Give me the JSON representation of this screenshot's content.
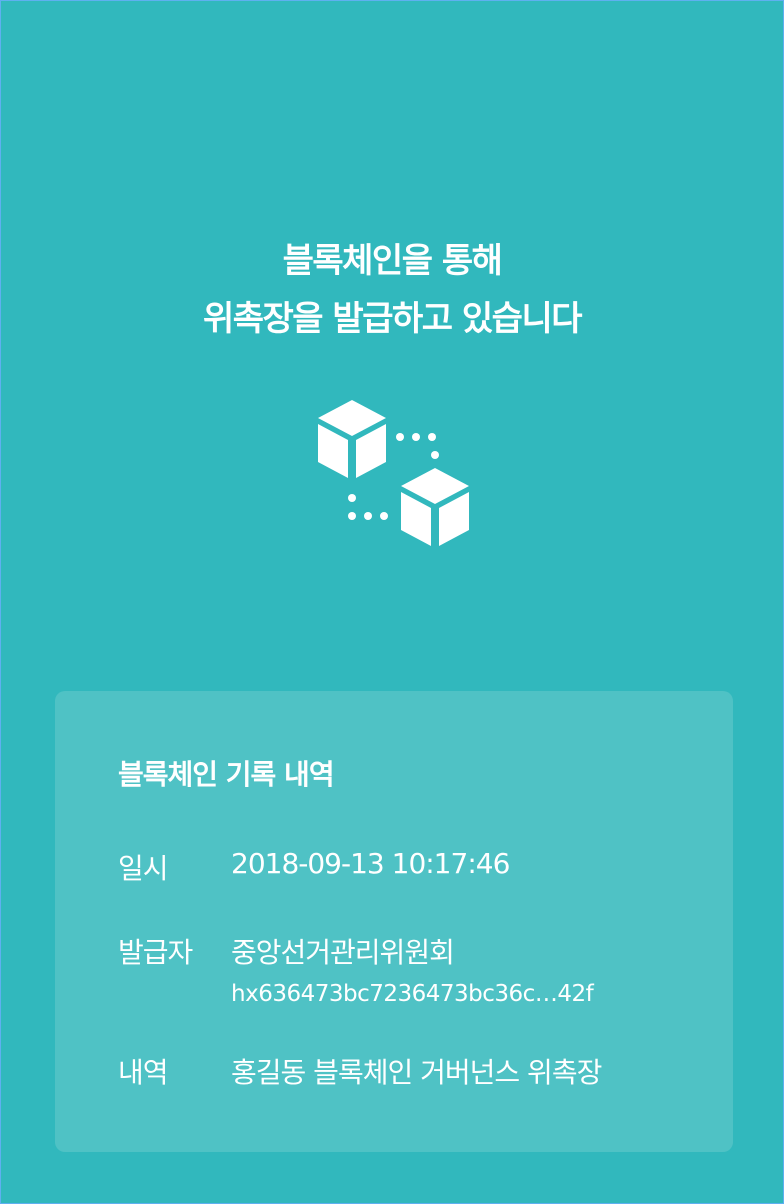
{
  "headline": {
    "line1": "블록체인을 통해",
    "line2": "위촉장을 발급하고 있습니다"
  },
  "illustration": {
    "icon": "blockchain-cubes-icon",
    "color": "#ffffff"
  },
  "record": {
    "title": "블록체인 기록 내역",
    "date_label": "일시",
    "date_value": "2018-09-13 10:17:46",
    "issuer_label": "발급자",
    "issuer_name": "중앙선거관리위원회",
    "issuer_address": "hx636473bc7236473bc36c…42f",
    "detail_label": "내역",
    "detail_value": "홍길동 블록체인 거버넌스 위촉장"
  },
  "colors": {
    "background": "#31b8bd",
    "card": "#4fc2c5",
    "text": "#ffffff"
  }
}
